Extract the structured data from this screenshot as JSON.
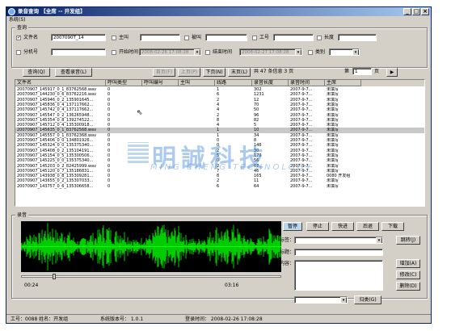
{
  "window": {
    "title": "录音查询  【全席 -- 开发组】"
  },
  "menu": {
    "system": "系统(S)"
  },
  "query": {
    "group_label": "查询",
    "filename_label": "文件名",
    "filename_value": "2007090T_14",
    "caller_label": "主叫",
    "called_label": "被叫",
    "worker_id_label": "工号",
    "length_label": "长度",
    "ext_label": "分机号",
    "start_time_label": "开始时间",
    "start_time_value": "2008-02-26 17:08:28",
    "end_time_label": "结束时间",
    "end_time_value": "2008-02-27 17:08:28",
    "category_label": "类别"
  },
  "toolbar": {
    "query_btn": "查询(Q)",
    "view_btn": "查看录音(L)",
    "first_btn": "首页(F)",
    "prev_btn": "上页(P)",
    "next_btn": "下页(N)",
    "last_btn": "末页(L)",
    "summary": "共  47 条信息   3 页",
    "page_label": "第",
    "page_value": "1",
    "page_unit": "页",
    "go_btn": "▶"
  },
  "table": {
    "headers": [
      "文件名",
      "呼叫类型",
      "呼叫编号",
      "主叫",
      "线路",
      "录音长度",
      "录音时间",
      "主席"
    ],
    "rows": [
      [
        "20070907_145917_0_1_83762568.wav",
        "0",
        "",
        "",
        "1",
        "302",
        "2007-9-7...",
        "未填写"
      ],
      [
        "20070907_144230_0_6_83762216.wav",
        "0",
        "",
        "",
        "6",
        "1231",
        "2007-9-7...",
        "未填写"
      ],
      [
        "20070907_145946_0_2_135901645...",
        "0",
        "",
        "",
        "2",
        "12",
        "2007-9-7...",
        "未填写"
      ],
      [
        "20070907_145836_0_4_137117662...",
        "0",
        "",
        "",
        "4",
        "70",
        "2007-9-7...",
        "未填写"
      ],
      [
        "20070907_145742_0_4_137117662...",
        "0",
        "",
        "",
        "4",
        "50",
        "2007-9-7...",
        "未填写"
      ],
      [
        "20070907_145547_0_2_136265948...",
        "0",
        "",
        "",
        "2",
        "96",
        "2007-9-7...",
        "未填写"
      ],
      [
        "20070907_145354_0_8_139274522...",
        "0",
        "",
        "",
        "8",
        "82",
        "2007-9-7...",
        "未填写"
      ],
      [
        "20070907_145712_0_4_135300918...",
        "0",
        "",
        "",
        "4",
        "5",
        "2007-9-7...",
        "未填写"
      ],
      [
        "20070907_145635_0_1_83762568.wav",
        "0",
        "",
        "",
        "1",
        "10",
        "2007-9-7...",
        "未填写"
      ],
      [
        "20070907_145557_0_1_83762368.wav",
        "0",
        "",
        "",
        "1",
        "34",
        "2007-9-7...",
        "未填写"
      ],
      [
        "20070907_145406_0_0_134801926...",
        "0",
        "",
        "",
        "0",
        "8",
        "2007-9-7...",
        "未填写"
      ],
      [
        "20070907_145324_0_0_135375340...",
        "0",
        "",
        "",
        "0",
        "146",
        "2007-9-7...",
        "未填写"
      ],
      [
        "20070907_145408_0_2_135104191...",
        "0",
        "",
        "",
        "2",
        "30",
        "2007-9-7...",
        "未填写"
      ],
      [
        "20070907_145154_0_5_135300506...",
        "0",
        "",
        "",
        "5",
        "179",
        "2007-9-7...",
        "未填写"
      ],
      [
        "20070907_145225_0_0_135375340...",
        "0",
        "",
        "",
        "0",
        "56",
        "2007-9-7...",
        "未填写"
      ],
      [
        "20070907_145203_0_2_82425999.wav",
        "0",
        "",
        "",
        "2",
        "67",
        "2007-9-7...",
        "未填写"
      ],
      [
        "20070907_145120_0_7_135186831...",
        "0",
        "",
        "",
        "7",
        "46",
        "2007-9-7...",
        "未填写"
      ],
      [
        "20070907_143938_0_8_135309281...",
        "0",
        "",
        "",
        "8",
        "165",
        "2007-9-7...",
        "0080 开发组"
      ],
      [
        "20070907_143655_0_2_135307033...",
        "0",
        "",
        "",
        "2",
        "11",
        "2007-9-7...",
        "未填写"
      ],
      [
        "20070907_143757_0_6_135306658...",
        "0",
        "",
        "",
        "6",
        "64",
        "2007-9-7...",
        "未填写"
      ]
    ]
  },
  "watermark": {
    "cn": "明誠科技",
    "en": "MING CHENG TECHNOLOGY"
  },
  "player": {
    "group_label": "录音",
    "pause_btn": "暂停",
    "stop_btn": "停止",
    "forward_btn": "快进",
    "back_btn": "后退",
    "download_btn": "下载",
    "time_current": "00:24",
    "time_total": "03:16",
    "progress": 0.12,
    "tag_label": "标签：",
    "jump_btn": "跳转(J)",
    "title_label": "标题：",
    "content_label": "内容：",
    "add_btn": "增加(A)",
    "edit_btn": "修改(C)",
    "delete_btn": "删除(D)",
    "return_btn": "归类(G)"
  },
  "status": {
    "worker": "工号：0088  姓名：开发组",
    "version": "系统版本号：  1.0.1",
    "login": "登录时间：  2008-02-26 17:08:28"
  },
  "colors": {
    "title_start": "#0a246a",
    "title_end": "#a6caf0",
    "wave": "#00ff00",
    "window": "#d4d0c8"
  }
}
